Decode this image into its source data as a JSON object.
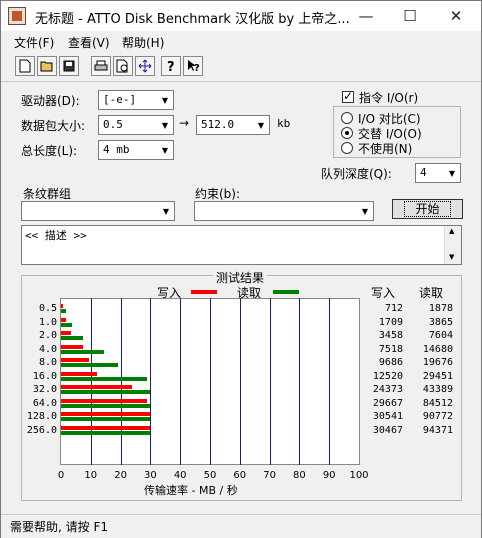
{
  "window": {
    "title": "无标题 - ATTO Disk Benchmark 汉化版 by 上帝之...",
    "minimize": "—",
    "maximize": "☐",
    "close": "✕"
  },
  "menu": [
    "文件(F)",
    "查看(V)",
    "帮助(H)"
  ],
  "toolbar": [
    "new-icon",
    "open-icon",
    "save-icon",
    "print-icon",
    "print-preview-icon",
    "move-icon",
    "help-icon",
    "context-help-icon"
  ],
  "settings": {
    "drive_label": "驱动器(D):",
    "drive_value": "[-e-]",
    "transfer_label": "数据包大小:",
    "transfer_from": "0.5",
    "transfer_to": "512.0",
    "transfer_unit": "kb",
    "arrow": "→",
    "total_label": "总长度(L):",
    "total_value": "4 mb",
    "io_label": "指令 I/O(r)",
    "io_compare": "I/O 对比(C)",
    "io_overlap": "交替 I/O(O)",
    "io_neither": "不使用(N)",
    "queue_label": "队列深度(Q):",
    "queue_value": "4",
    "stripe_label": "条纹群组",
    "restrict_label": "约束(b):",
    "start_button": "开始",
    "description": "<< 描述 >>"
  },
  "results": {
    "title": "测试结果",
    "legend_write": "写入",
    "legend_read": "读取",
    "col_write": "写入",
    "col_read": "读取",
    "x_axis_label": "传输速率 - MB / 秒",
    "colors": {
      "write": "#ff0000",
      "read": "#008000",
      "grid": "#1a1aa0"
    }
  },
  "chart_data": {
    "type": "bar",
    "orientation": "horizontal",
    "categories": [
      "0.5",
      "1.0",
      "2.0",
      "4.0",
      "8.0",
      "16.0",
      "32.0",
      "64.0",
      "128.0",
      "256.0"
    ],
    "series": [
      {
        "name": "写入",
        "values": [
          712,
          1709,
          3458,
          7518,
          9686,
          12520,
          24373,
          29667,
          30541,
          30467
        ]
      },
      {
        "name": "读取",
        "values": [
          1878,
          3865,
          7604,
          14680,
          19676,
          29451,
          43389,
          84512,
          90772,
          94371
        ]
      }
    ],
    "x_ticks": [
      "0",
      "10",
      "20",
      "30",
      "40",
      "50",
      "60",
      "70",
      "80",
      "90",
      "100"
    ],
    "xlim": [
      0,
      100
    ],
    "bar_cap": 30,
    "xlabel": "传输速率 - MB / 秒",
    "grid": true,
    "legend": "top"
  },
  "status": {
    "text": "需要帮助, 请按 F1"
  }
}
